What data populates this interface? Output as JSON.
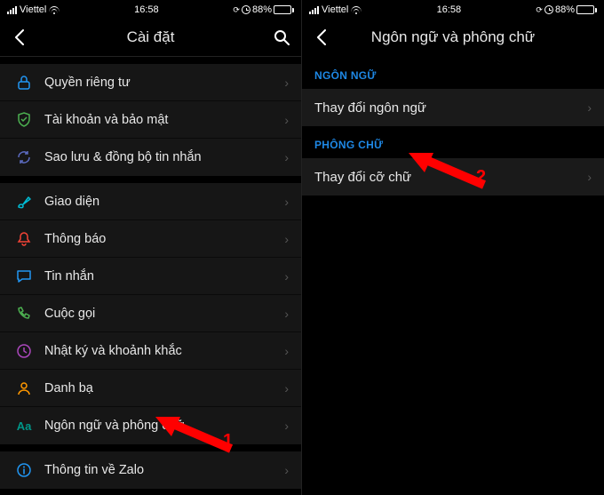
{
  "status": {
    "carrier": "Viettel",
    "time": "16:58",
    "battery_pct": "88%"
  },
  "left": {
    "title": "Cài đặt",
    "items": [
      {
        "id": "privacy",
        "label": "Quyền riêng tư",
        "icon": "lock",
        "color": "#2196f3"
      },
      {
        "id": "security",
        "label": "Tài khoản và bảo mật",
        "icon": "shield",
        "color": "#4caf50"
      },
      {
        "id": "backup",
        "label": "Sao lưu & đồng bộ tin nhắn",
        "icon": "sync",
        "color": "#3f51b5"
      },
      {
        "id": "ui",
        "label": "Giao diện",
        "icon": "brush",
        "color": "#00bcd4"
      },
      {
        "id": "notif",
        "label": "Thông báo",
        "icon": "bell",
        "color": "#f44336"
      },
      {
        "id": "msg",
        "label": "Tin nhắn",
        "icon": "chat",
        "color": "#2196f3"
      },
      {
        "id": "call",
        "label": "Cuộc gọi",
        "icon": "phone",
        "color": "#4caf50"
      },
      {
        "id": "diary",
        "label": "Nhật ký và khoảnh khắc",
        "icon": "clock",
        "color": "#9c27b0"
      },
      {
        "id": "contacts",
        "label": "Danh bạ",
        "icon": "person",
        "color": "#ff9800"
      },
      {
        "id": "lang",
        "label": "Ngôn ngữ và phông chữ",
        "icon": "Aa",
        "color": "#009688"
      },
      {
        "id": "about",
        "label": "Thông tin về Zalo",
        "icon": "info",
        "color": "#2196f3"
      }
    ]
  },
  "right": {
    "title": "Ngôn ngữ và phông chữ",
    "section_lang": "NGÔN NGỮ",
    "row_lang": "Thay đổi ngôn ngữ",
    "section_font": "PHÔNG CHỮ",
    "row_font": "Thay đổi cỡ chữ"
  },
  "callouts": {
    "one": "1",
    "two": "2"
  }
}
